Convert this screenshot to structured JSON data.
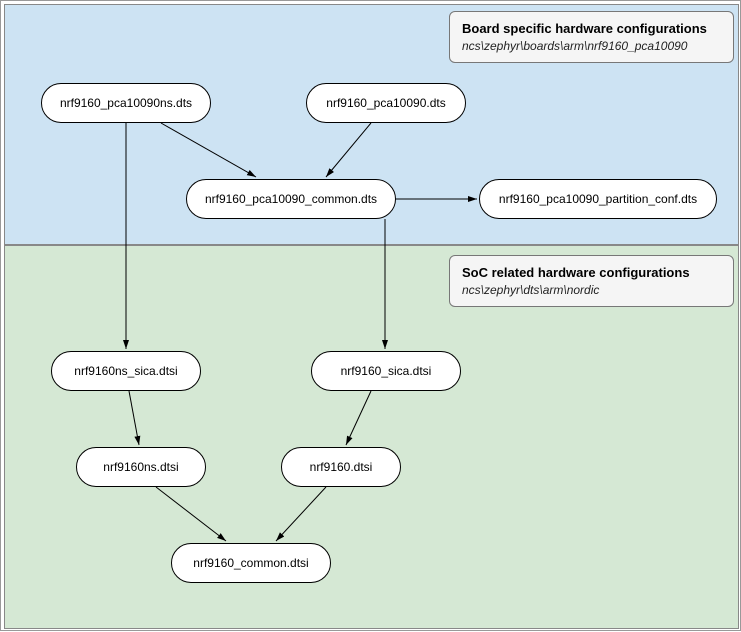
{
  "chart_data": {
    "type": "graph",
    "regions": [
      {
        "id": "board",
        "title": "Board specific hardware configurations",
        "path": "ncs\\zephyr\\boards\\arm\\nrf9160_pca10090"
      },
      {
        "id": "soc",
        "title": "SoC related hardware configurations",
        "path": "ncs\\zephyr\\dts\\arm\\nordic"
      }
    ],
    "nodes": [
      {
        "id": "n1",
        "label": "nrf9160_pca10090ns.dts",
        "region": "board"
      },
      {
        "id": "n2",
        "label": "nrf9160_pca10090.dts",
        "region": "board"
      },
      {
        "id": "n3",
        "label": "nrf9160_pca10090_common.dts",
        "region": "board"
      },
      {
        "id": "n4",
        "label": "nrf9160_pca10090_partition_conf.dts",
        "region": "board"
      },
      {
        "id": "n5",
        "label": "nrf9160ns_sica.dtsi",
        "region": "soc"
      },
      {
        "id": "n6",
        "label": "nrf9160_sica.dtsi",
        "region": "soc"
      },
      {
        "id": "n7",
        "label": "nrf9160ns.dtsi",
        "region": "soc"
      },
      {
        "id": "n8",
        "label": "nrf9160.dtsi",
        "region": "soc"
      },
      {
        "id": "n9",
        "label": "nrf9160_common.dtsi",
        "region": "soc"
      }
    ],
    "edges": [
      {
        "from": "n1",
        "to": "n3"
      },
      {
        "from": "n2",
        "to": "n3"
      },
      {
        "from": "n3",
        "to": "n4"
      },
      {
        "from": "n1",
        "to": "n5"
      },
      {
        "from": "n3",
        "to": "n6"
      },
      {
        "from": "n5",
        "to": "n7"
      },
      {
        "from": "n6",
        "to": "n8"
      },
      {
        "from": "n7",
        "to": "n9"
      },
      {
        "from": "n8",
        "to": "n9"
      }
    ]
  }
}
